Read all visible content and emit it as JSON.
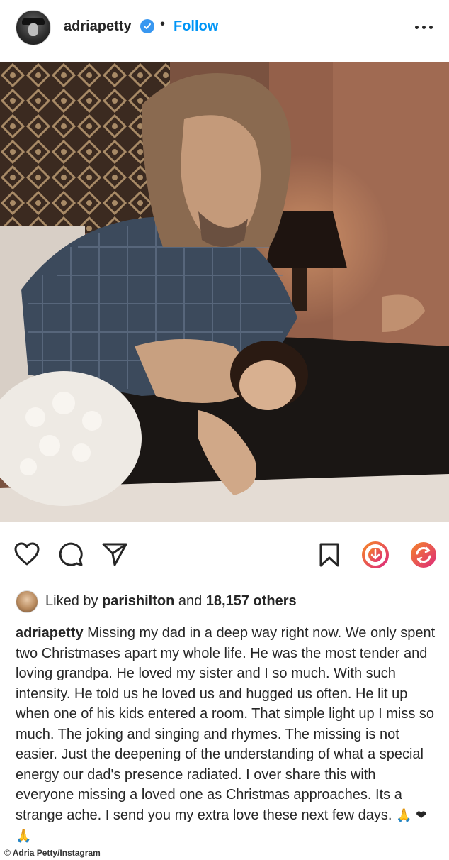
{
  "header": {
    "username": "adriapetty",
    "separator": "•",
    "follow_label": "Follow"
  },
  "icons": {
    "verified": "verified-badge-icon",
    "more": "more-options-icon",
    "like": "heart-icon",
    "comment": "comment-icon",
    "share": "send-icon",
    "save": "bookmark-icon",
    "download": "download-icon",
    "repost": "repost-icon"
  },
  "colors": {
    "follow": "#0095f6",
    "verified": "#3897f0",
    "download_gradient_start": "#f58529",
    "download_gradient_end": "#dd2a7b"
  },
  "likes": {
    "prefix": "Liked by",
    "user": "parishilton",
    "middle": "and",
    "count": "18,157 others"
  },
  "caption": {
    "username": "adriapetty",
    "text": "Missing my dad in a deep way right now. We only spent two Christmases apart my whole life. He was the most tender and loving grandpa. He loved my sister and I so much. With such intensity. He told us he loved us and hugged us often. He lit up when one of his kids entered a room. That simple light up I miss so much. The joking and singing and rhymes. The missing is not easier. Just the deepening of the understanding of what a special energy our dad's presence radiated. I over share this with everyone missing a loved one as Christmas approaches. Its a strange ache. I send you my extra love these next few days.",
    "emojis": "🙏 ❤ 🙏"
  },
  "credit": "© Adria Petty/Instagram"
}
